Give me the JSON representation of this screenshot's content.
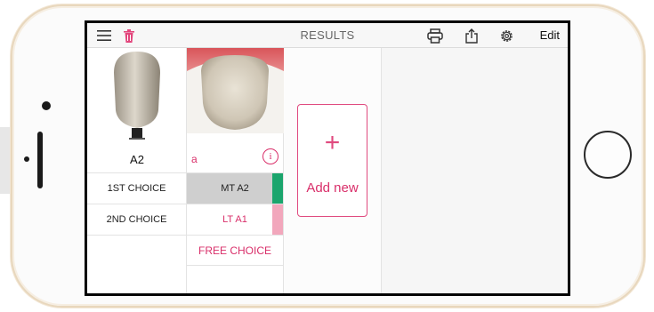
{
  "header": {
    "title": "RESULTS",
    "edit_label": "Edit",
    "icons": [
      "menu-icon",
      "trash-icon",
      "printer-icon",
      "share-icon",
      "settings-icon"
    ]
  },
  "reference": {
    "shade": "A2",
    "choices": [
      {
        "label": "1ST CHOICE"
      },
      {
        "label": "2ND CHOICE"
      }
    ]
  },
  "result": {
    "marker": "a",
    "choices": [
      {
        "label": "MT A2",
        "color": "#1ba56d"
      },
      {
        "label": "LT A1",
        "color": "#f2a7bc"
      }
    ],
    "free_choice": "FREE CHOICE"
  },
  "add_new": {
    "label": "Add new",
    "symbol": "+"
  },
  "colors": {
    "accent": "#d92f6a",
    "mt_swatch": "#1ba56d",
    "lt_swatch": "#f2a7bc"
  }
}
